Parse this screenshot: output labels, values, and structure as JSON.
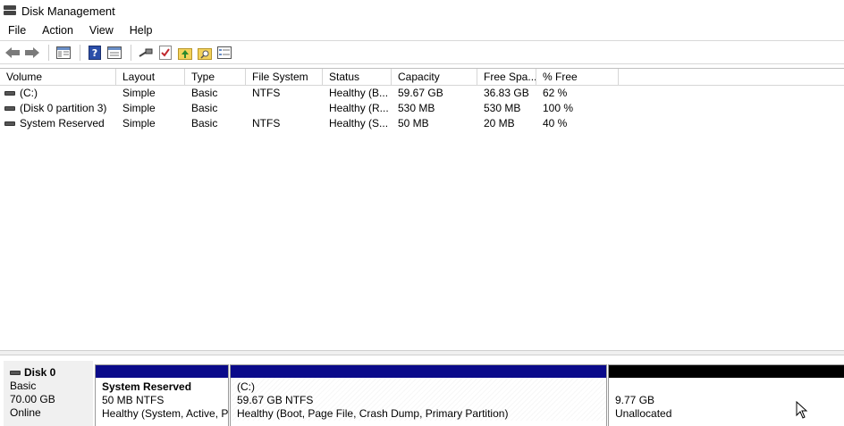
{
  "window": {
    "title": "Disk Management"
  },
  "menu": [
    "File",
    "Action",
    "View",
    "Help"
  ],
  "toolbar": {
    "buttons": [
      "back-arrow-icon",
      "forward-arrow-icon",
      "console-tree-icon",
      "help-icon",
      "properties-icon",
      "connect-icon",
      "check-icon",
      "folder-up-icon",
      "folder-search-icon",
      "list-view-icon"
    ]
  },
  "volume_list": {
    "columns": [
      "Volume",
      "Layout",
      "Type",
      "File System",
      "Status",
      "Capacity",
      "Free Spa...",
      "% Free"
    ],
    "rows": [
      [
        "(C:)",
        "Simple",
        "Basic",
        "NTFS",
        "Healthy (B...",
        "59.67 GB",
        "36.83 GB",
        "62 %"
      ],
      [
        "(Disk 0 partition 3)",
        "Simple",
        "Basic",
        "",
        "Healthy (R...",
        "530 MB",
        "530 MB",
        "100 %"
      ],
      [
        "System Reserved",
        "Simple",
        "Basic",
        "NTFS",
        "Healthy (S...",
        "50 MB",
        "20 MB",
        "40 %"
      ]
    ]
  },
  "disk": {
    "name": "Disk 0",
    "type": "Basic",
    "size": "70.00 GB",
    "state": "Online",
    "partitions": [
      {
        "name": "System Reserved",
        "size": "50 MB NTFS",
        "status": "Healthy (System, Active, P",
        "kind": "primary"
      },
      {
        "name": "(C:)",
        "size": "59.67 GB NTFS",
        "status": "Healthy (Boot, Page File, Crash Dump, Primary Partition)",
        "kind": "primary"
      },
      {
        "name": "",
        "size": "9.77 GB",
        "status": "Unallocated",
        "kind": "unallocated"
      }
    ]
  },
  "colors": {
    "primary_partition": "#0a0a8a",
    "unallocated": "#000000"
  }
}
